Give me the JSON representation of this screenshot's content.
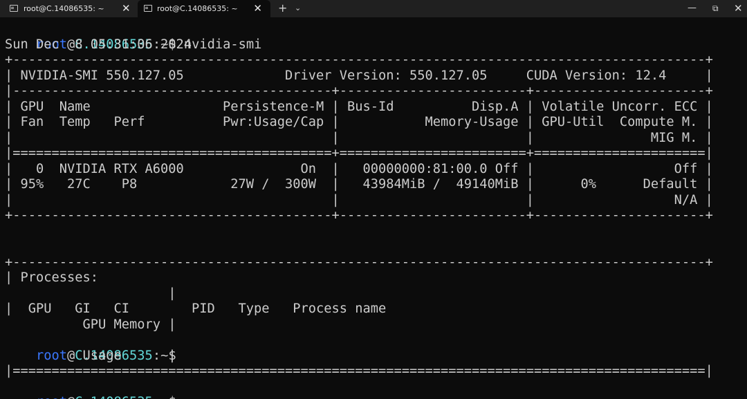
{
  "tabs": [
    {
      "title": "root@C.14086535: ~",
      "close": "✕"
    },
    {
      "title": "root@C.14086535: ~",
      "close": "✕"
    }
  ],
  "tabbar": {
    "new_tab": "+",
    "dropdown": "⌄"
  },
  "window": {
    "minimize": "—",
    "maximize": "⧉",
    "close": "✕"
  },
  "colors": {
    "prompt_user": "#3b78ff",
    "prompt_host": "#61d6d6",
    "text": "#cccccc",
    "background": "#0c0c0c"
  },
  "prompt": {
    "user": "root",
    "at": "@",
    "host": "C.14086535",
    "suffix": ":~$"
  },
  "terminal": {
    "command": " nvidia-smi",
    "lines": [
      "Sun Dec  8 05:31:06 2024",
      "+-----------------------------------------------------------------------------------------+",
      "| NVIDIA-SMI 550.127.05             Driver Version: 550.127.05     CUDA Version: 12.4     |",
      "|-----------------------------------------+------------------------+----------------------+",
      "| GPU  Name                 Persistence-M | Bus-Id          Disp.A | Volatile Uncorr. ECC |",
      "| Fan  Temp   Perf          Pwr:Usage/Cap |           Memory-Usage | GPU-Util  Compute M. |",
      "|                                         |                        |               MIG M. |",
      "|=========================================+========================+======================|",
      "|   0  NVIDIA RTX A6000               On  |   00000000:81:00.0 Off |                  Off |",
      "| 95%   27C    P8            27W /  300W  |   43984MiB /  49140MiB |      0%      Default |",
      "|                                         |                        |                  N/A |",
      "+-----------------------------------------+------------------------+----------------------+",
      "",
      "",
      "+-----------------------------------------------------------------------------------------+",
      "| Processes:",
      "                     |",
      "|  GPU   GI   CI        PID   Type   Process name",
      "          GPU Memory |"
    ],
    "usage_line": "          Usage      |",
    "double_rule": "|=========================================================================================|",
    "tail": "                                                                  -------+"
  }
}
